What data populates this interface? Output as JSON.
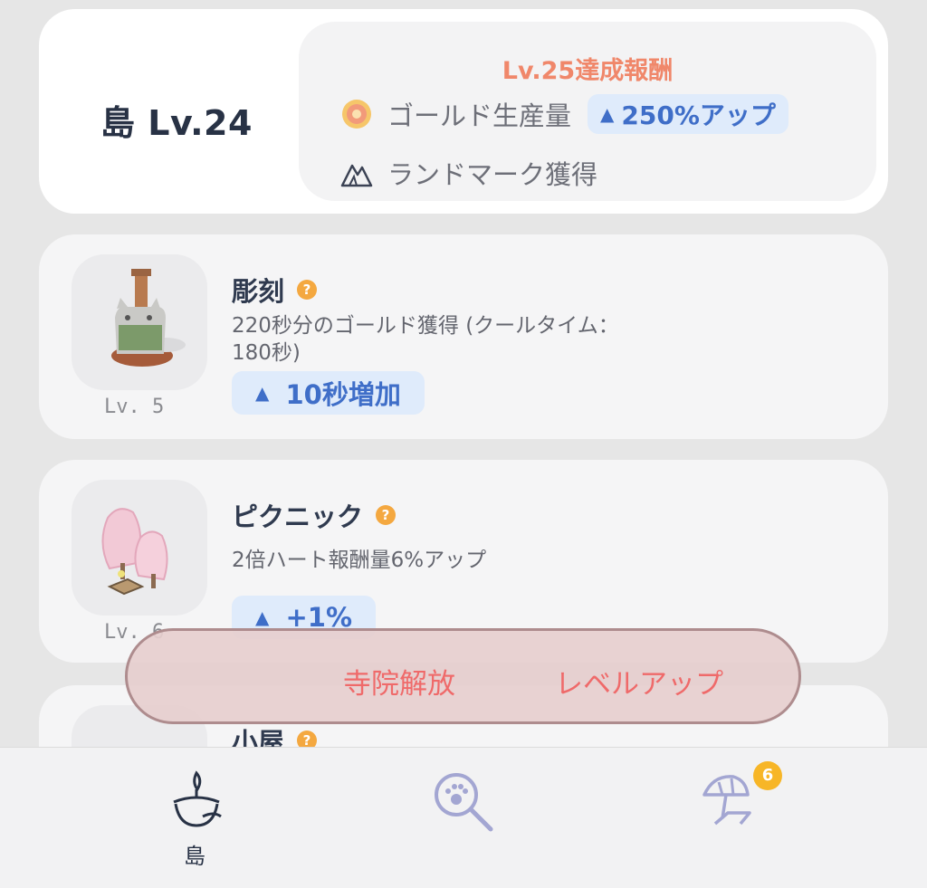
{
  "header": {
    "island_level": "島 Lv.24",
    "reward_title": "Lv.25達成報酬",
    "rewards": [
      {
        "icon": "gold-coin-icon",
        "label": "ゴールド生産量",
        "badge": "250%アップ"
      },
      {
        "icon": "landmark-mountain-icon",
        "label": "ランドマーク獲得"
      }
    ]
  },
  "items": [
    {
      "title": "彫刻",
      "help": "?",
      "desc_line1": "220秒分のゴールド獲得 (クールタイム：",
      "desc_line2": "180秒)",
      "badge": "10秒増加",
      "level": "Lv. 5",
      "icon": "cat-statue-icon"
    },
    {
      "title": "ピクニック",
      "help": "?",
      "desc_line1": "2倍ハート報酬量6%アップ",
      "badge": "+1%",
      "level": "Lv. 6",
      "icon": "cherry-blossom-trees-icon"
    },
    {
      "title": "小屋",
      "help": "?",
      "icon": "hut-icon"
    }
  ],
  "overlay": {
    "left_label": "寺院解放",
    "right_label": "レベルアップ"
  },
  "tabbar": {
    "tabs": [
      {
        "label": "島",
        "icon": "island-cup-icon",
        "active": true
      },
      {
        "label": "",
        "icon": "paw-magnifier-icon"
      },
      {
        "label": "",
        "icon": "beach-umbrella-icon",
        "badge": "6"
      }
    ]
  },
  "colors": {
    "accent_orange": "#f0876a",
    "accent_blue": "#3f6ec8",
    "badge_blue_bg": "#dfebfb",
    "overlay_text": "#ef6a6a",
    "notif_badge": "#f7b627"
  }
}
